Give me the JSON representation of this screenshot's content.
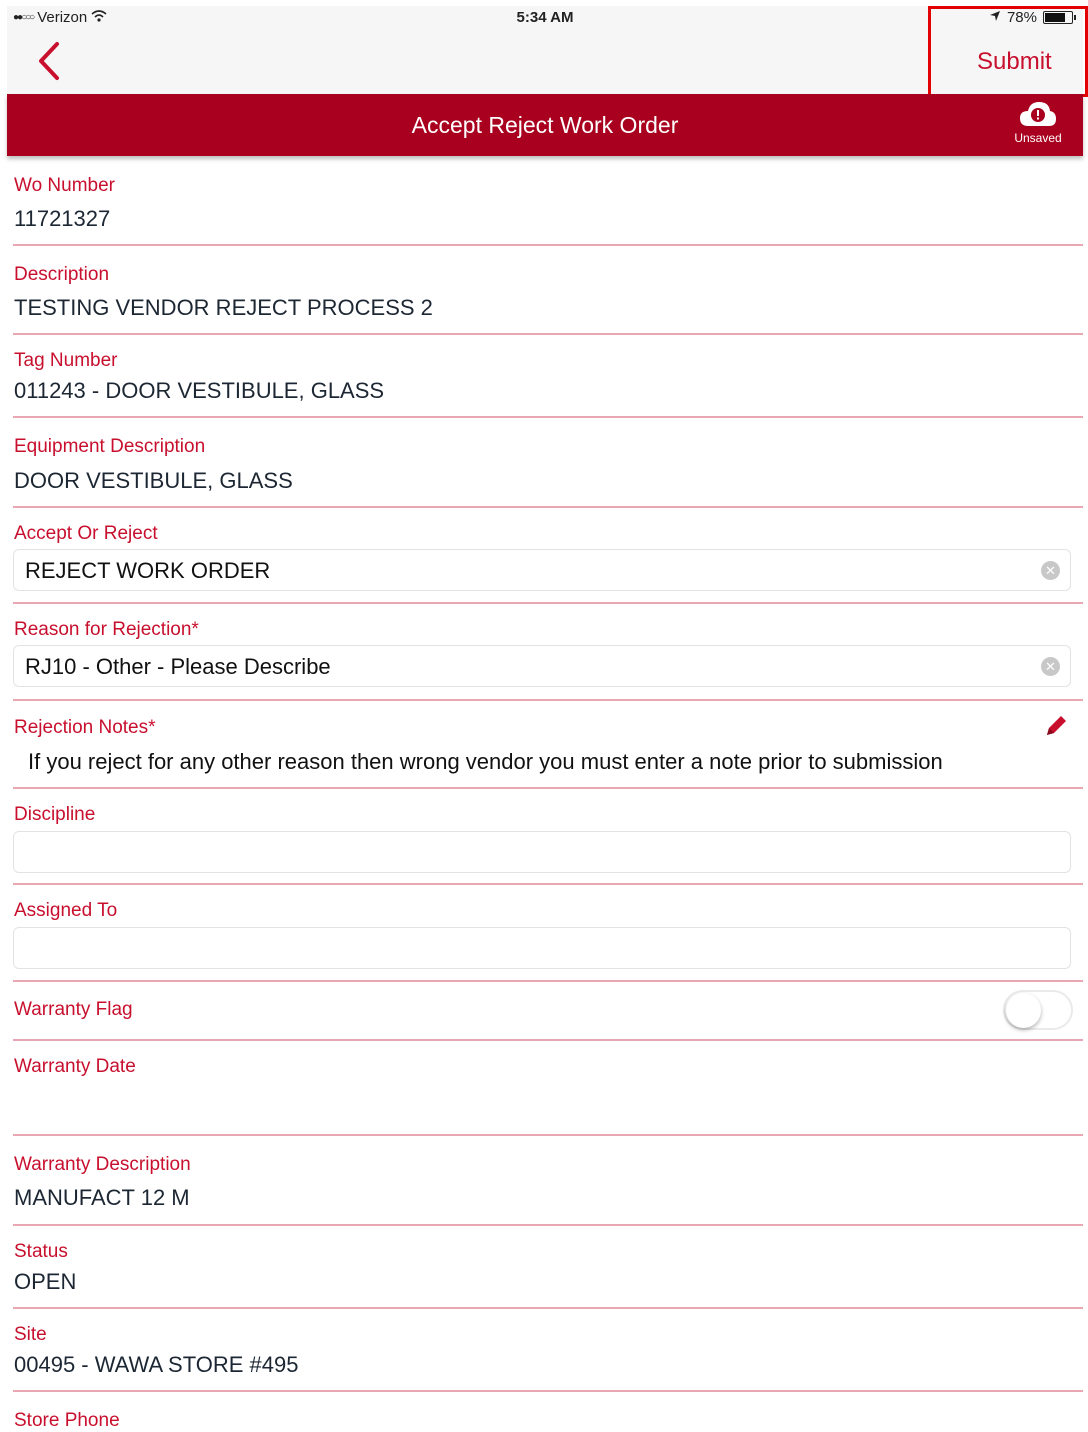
{
  "status_bar": {
    "carrier": "Verizon",
    "time": "5:34 AM",
    "battery": "78%",
    "battery_level": 0.78
  },
  "nav": {
    "submit_label": "Submit"
  },
  "header": {
    "title": "Accept Reject Work Order",
    "sync_status": "Unsaved"
  },
  "fields": {
    "wo_number": {
      "label": "Wo Number",
      "value": "11721327"
    },
    "description": {
      "label": "Description",
      "value": "TESTING VENDOR REJECT PROCESS 2"
    },
    "tag_number": {
      "label": "Tag Number",
      "value": "011243 - DOOR VESTIBULE, GLASS"
    },
    "equipment_description": {
      "label": "Equipment Description",
      "value": "DOOR VESTIBULE, GLASS"
    },
    "accept_or_reject": {
      "label": "Accept Or Reject",
      "value": "REJECT WORK ORDER"
    },
    "reason_for_rejection": {
      "label": "Reason for Rejection*",
      "value": "RJ10 - Other - Please Describe"
    },
    "rejection_notes": {
      "label": "Rejection Notes*",
      "value": "If you reject for any other reason then wrong vendor you must enter a note prior to submission"
    },
    "discipline": {
      "label": "Discipline",
      "value": ""
    },
    "assigned_to": {
      "label": "Assigned To",
      "value": ""
    },
    "warranty_flag": {
      "label": "Warranty Flag",
      "on": false
    },
    "warranty_date": {
      "label": "Warranty Date",
      "value": ""
    },
    "warranty_description": {
      "label": "Warranty Description",
      "value": "MANUFACT 12 M"
    },
    "status": {
      "label": "Status",
      "value": "OPEN"
    },
    "site": {
      "label": "Site",
      "value": "00495 - WAWA STORE #495"
    },
    "store_phone": {
      "label": "Store Phone",
      "value": ""
    }
  },
  "colors": {
    "brand_red": "#a8001e",
    "label_red": "#c8102e",
    "divider": "#e8a7b3",
    "highlight": "#e20000"
  }
}
